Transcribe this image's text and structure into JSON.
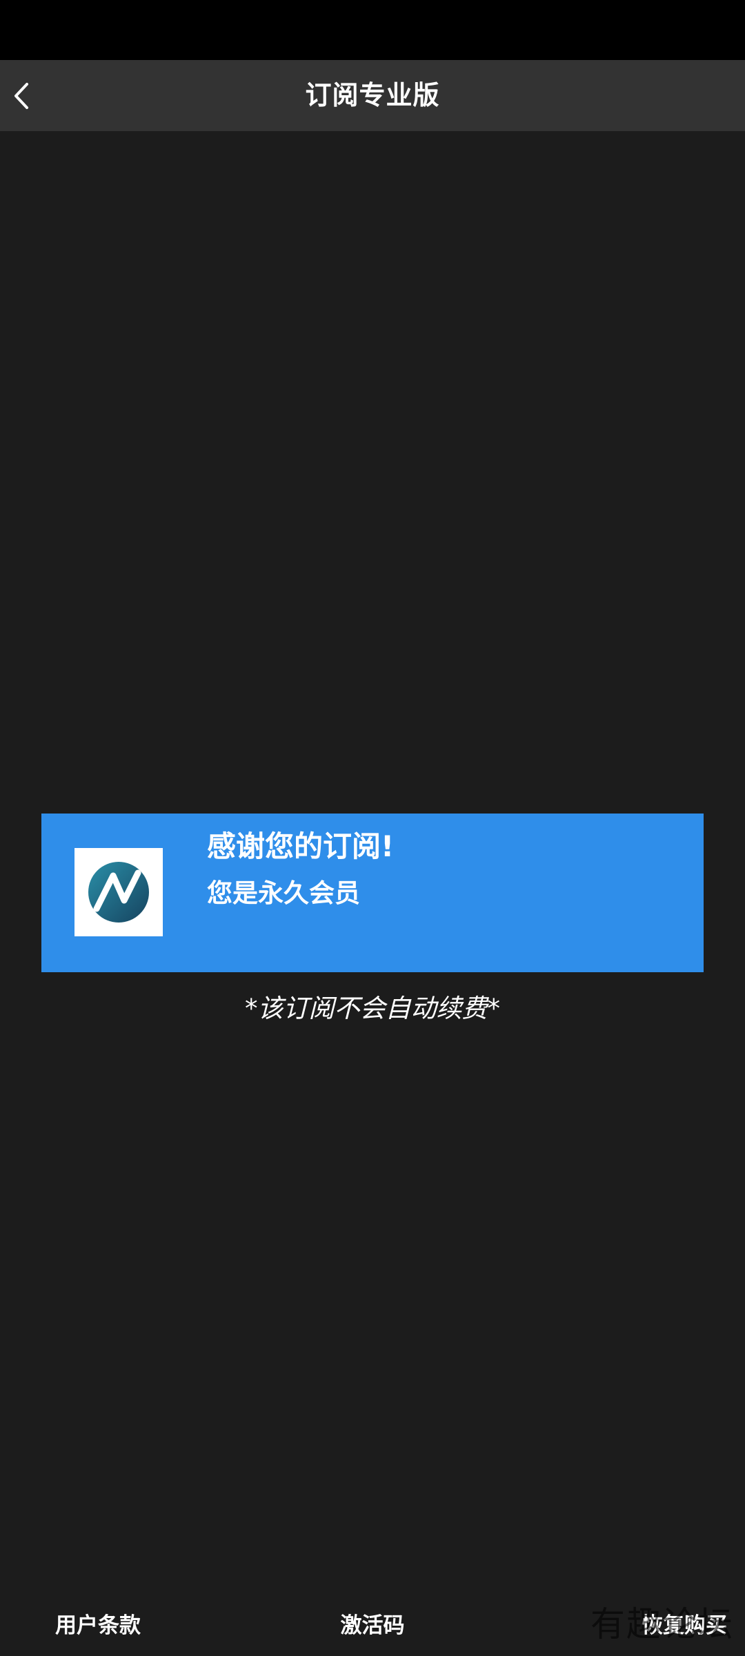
{
  "header": {
    "title": "订阅专业版",
    "back_icon": "chevron-left-icon"
  },
  "card": {
    "title": "感谢您的订阅!",
    "subtitle": "您是永久会员",
    "logo_icon": "app-logo-icon",
    "background_color": "#2f8eea"
  },
  "note": "*该订阅不会自动续费*",
  "footer": {
    "terms_label": "用户条款",
    "activation_label": "激活码",
    "restore_label": "恢复购买"
  },
  "watermark": "有趣论坛",
  "colors": {
    "status_bar": "#000000",
    "header_bar": "#333333",
    "background": "#1c1c1c",
    "text": "#ffffff"
  }
}
